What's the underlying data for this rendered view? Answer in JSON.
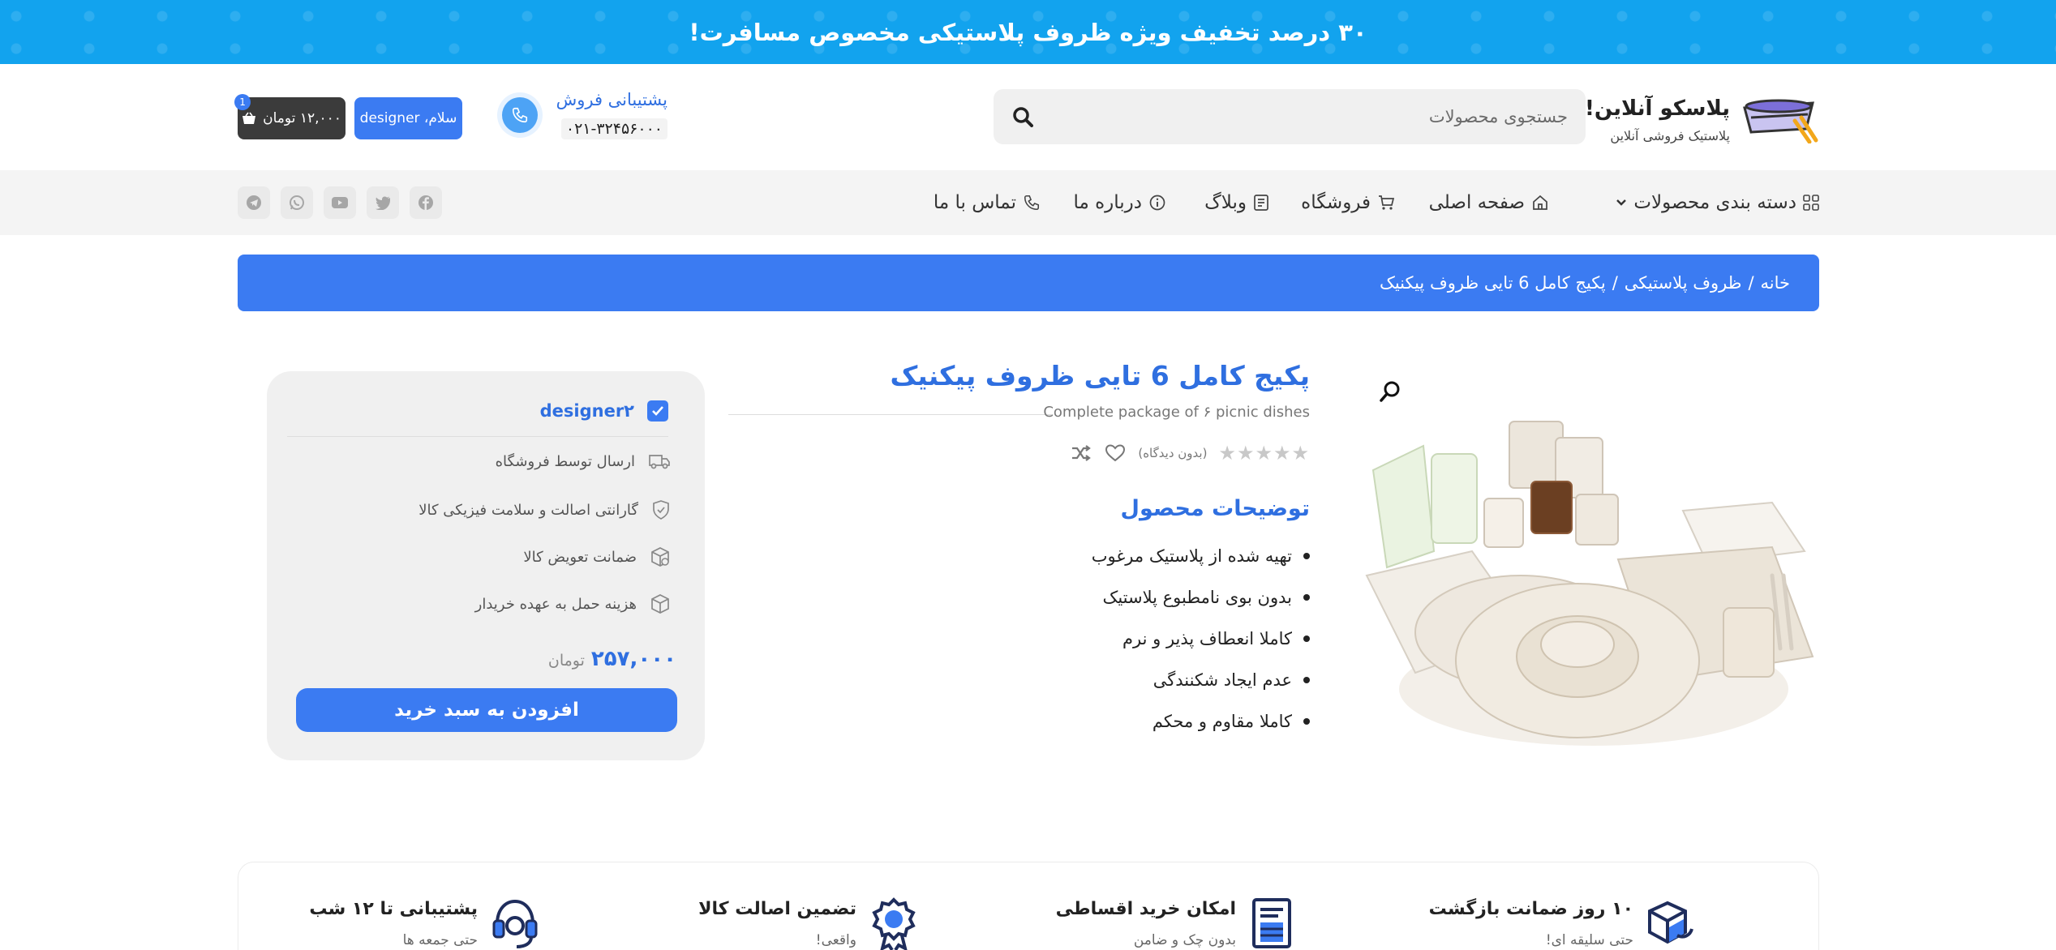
{
  "banner": {
    "text": "۳۰ درصد تخفیف ویژه ظروف پلاستیکی مخصوص مسافرت!"
  },
  "header": {
    "logo_title": "پلاسکو آنلاین!",
    "logo_subtitle": "پلاستیک فروشی آنلاین",
    "search_placeholder": "جستجوی محصولات",
    "support_label": "پشتیبانی فروش",
    "support_phone": "۰۲۱-۳۲۴۵۶۰۰۰",
    "user_label": "سلام، designer",
    "cart_label": "۱۲,۰۰۰ تومان",
    "cart_count": "1"
  },
  "nav": {
    "categories": "دسته بندی محصولات",
    "home": "صفحه اصلی",
    "shop": "فروشگاه",
    "blog": "وبلاگ",
    "about": "درباره ما",
    "contact": "تماس با ما",
    "socials": [
      "facebook-icon",
      "twitter-icon",
      "youtube-icon",
      "whatsapp-icon",
      "telegram-icon"
    ]
  },
  "breadcrumb": {
    "home": "خانه",
    "category": "ظروف پلاستیکی",
    "current": "پکیج کامل 6 تایی ظروف پیکنیک",
    "separator": "/"
  },
  "product": {
    "title": "پکیج کامل 6 تایی ظروف پیکنیک",
    "subtitle": "Complete package of ۶ picnic dishes",
    "stars": "★★★★★",
    "review_text": "(بدون دیدگاه)",
    "rating": 0,
    "desc_title": "توضیحات محصول",
    "desc_items": [
      "تهیه شده از پلاستیک مرغوب",
      "بدون بوی نامطبوع پلاستیک",
      "کاملا انعطاف پذیر و نرم",
      "عدم ایجاد شکنندگی",
      "کاملا مقاوم و محکم"
    ]
  },
  "buy_box": {
    "seller": "designer۲",
    "features": [
      "ارسال توسط فروشگاه",
      "گارانتی اصالت و سلامت فیزیکی کالا",
      "ضمانت تعویض کالا",
      "هزینه حمل به عهده خریدار"
    ],
    "price": "۲۵۷,۰۰۰",
    "price_unit": "تومان",
    "add_to_cart": "افزودن به سبد خرید"
  },
  "bottom_features": [
    {
      "title": "۱۰ روز ضمانت بازگشت",
      "subtitle": "حتی سلیقه ای!"
    },
    {
      "title": "امکان خرید اقساطی",
      "subtitle": "بدون چک و ضامن"
    },
    {
      "title": "تضمین اصالت کالا",
      "subtitle": "واقعی!"
    },
    {
      "title": "پشتیبانی تا ۱۲ شب",
      "subtitle": "حتی جمعه ها"
    }
  ],
  "colors": {
    "banner": "#12a3ee",
    "accent": "#3b7bf2",
    "title": "#2f6fe0",
    "dark": "#3b3b3b"
  }
}
